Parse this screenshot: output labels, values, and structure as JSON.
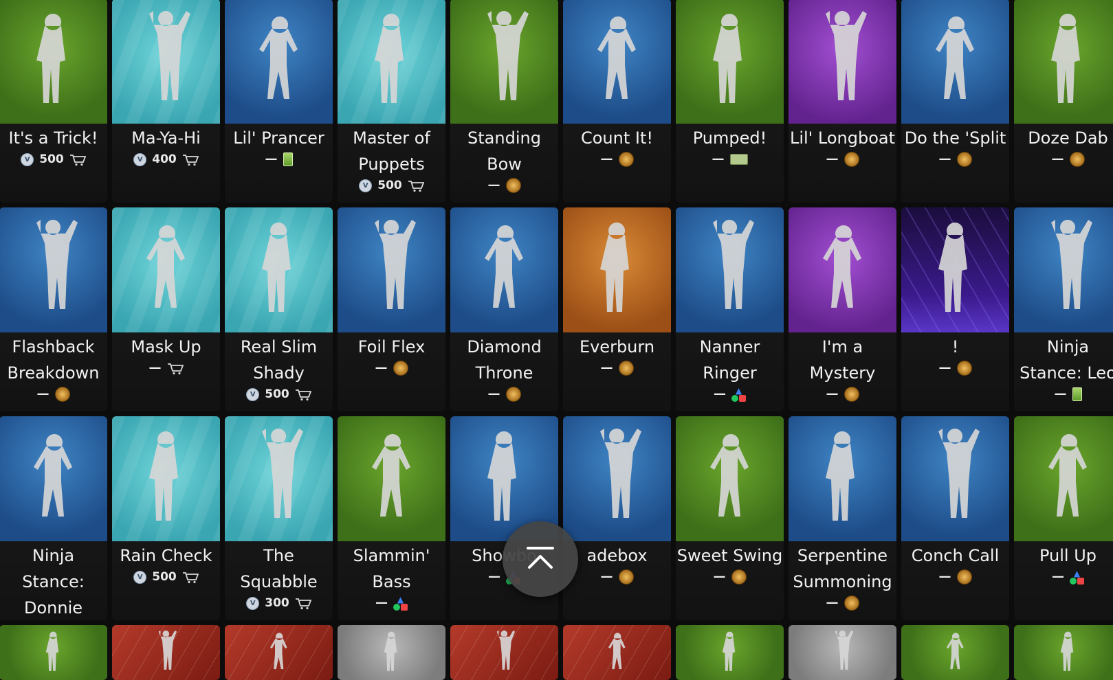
{
  "emotes": [
    {
      "name": "It's a Trick!",
      "bg": "green",
      "price": "500",
      "source": "shop"
    },
    {
      "name": "Ma-Ya-Hi",
      "bg": "teal",
      "price": "400",
      "source": "shop"
    },
    {
      "name": "Lil' Prancer",
      "bg": "blue",
      "price": "—",
      "source": "card"
    },
    {
      "name": "Master of Puppets",
      "bg": "teal",
      "price": "500",
      "source": "shop"
    },
    {
      "name": "Standing Bow",
      "bg": "green",
      "price": "—",
      "source": "battlepass"
    },
    {
      "name": "Count It!",
      "bg": "blue",
      "price": "—",
      "source": "battlepass"
    },
    {
      "name": "Pumped!",
      "bg": "green",
      "price": "—",
      "source": "cash"
    },
    {
      "name": "Lil' Longboat",
      "bg": "purple",
      "price": "—",
      "source": "battlepass"
    },
    {
      "name": "Do the 'Split",
      "bg": "blue",
      "price": "—",
      "source": "battlepass"
    },
    {
      "name": "Doze Dab",
      "bg": "green",
      "price": "—",
      "source": "battlepass"
    },
    {
      "name": "Flashback Breakdown",
      "bg": "blue",
      "price": "—",
      "source": "battlepass"
    },
    {
      "name": "Mask Up",
      "bg": "teal",
      "price": "—",
      "source": "shop"
    },
    {
      "name": "Real Slim Shady",
      "bg": "teal",
      "price": "500",
      "source": "shop"
    },
    {
      "name": "Foil Flex",
      "bg": "blue",
      "price": "—",
      "source": "battlepass"
    },
    {
      "name": "Diamond Throne",
      "bg": "blue",
      "price": "—",
      "source": "battlepass"
    },
    {
      "name": "Everburn",
      "bg": "orange",
      "price": "—",
      "source": "battlepass"
    },
    {
      "name": "Nanner Ringer",
      "bg": "blue",
      "price": "—",
      "source": "platform"
    },
    {
      "name": "I'm a Mystery",
      "bg": "purple",
      "price": "—",
      "source": "battlepass"
    },
    {
      "name": "!",
      "bg": "circuit",
      "price": "—",
      "source": "battlepass"
    },
    {
      "name": "Ninja Stance: Leo",
      "bg": "blue",
      "price": "—",
      "source": "card"
    },
    {
      "name": "Ninja Stance: Donnie",
      "bg": "blue",
      "price": "—",
      "source": "card"
    },
    {
      "name": "Rain Check",
      "bg": "teal",
      "price": "500",
      "source": "shop"
    },
    {
      "name": "The Squabble",
      "bg": "teal",
      "price": "300",
      "source": "shop"
    },
    {
      "name": "Slammin' Bass",
      "bg": "green",
      "price": "—",
      "source": "platform"
    },
    {
      "name": "Showbo",
      "bg": "blue",
      "price": "—",
      "source": "platform"
    },
    {
      "name": "adebox",
      "bg": "blue",
      "price": "—",
      "source": "battlepass"
    },
    {
      "name": "Sweet Swing",
      "bg": "green",
      "price": "—",
      "source": "battlepass"
    },
    {
      "name": "Serpentine Summoning",
      "bg": "blue",
      "price": "—",
      "source": "battlepass"
    },
    {
      "name": "Conch Call",
      "bg": "blue",
      "price": "—",
      "source": "battlepass"
    },
    {
      "name": "Pull Up",
      "bg": "green",
      "price": "—",
      "source": "platform"
    },
    {
      "name": "",
      "bg": "green",
      "price": "",
      "source": ""
    },
    {
      "name": "",
      "bg": "red",
      "price": "",
      "source": ""
    },
    {
      "name": "",
      "bg": "red",
      "price": "",
      "source": ""
    },
    {
      "name": "",
      "bg": "gray",
      "price": "",
      "source": ""
    },
    {
      "name": "",
      "bg": "red",
      "price": "",
      "source": ""
    },
    {
      "name": "",
      "bg": "red",
      "price": "",
      "source": ""
    },
    {
      "name": "",
      "bg": "green",
      "price": "",
      "source": ""
    },
    {
      "name": "",
      "bg": "gray",
      "price": "",
      "source": ""
    },
    {
      "name": "",
      "bg": "green",
      "price": "",
      "source": ""
    },
    {
      "name": "",
      "bg": "green",
      "price": "",
      "source": ""
    }
  ],
  "vbucks_symbol": "V",
  "scroll_top_icon": "chevron-up-to-top-icon"
}
